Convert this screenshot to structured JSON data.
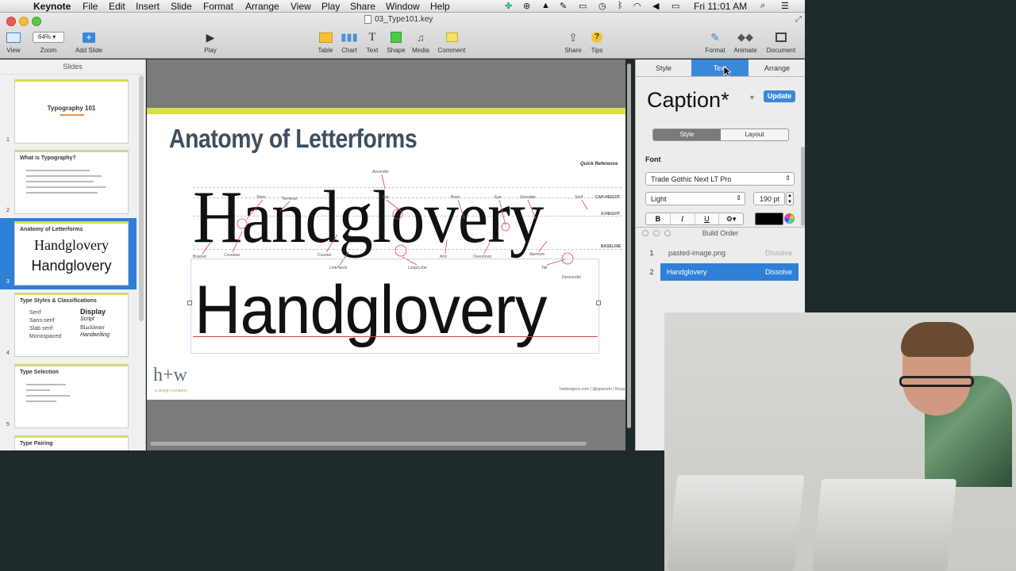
{
  "menubar": {
    "apple_icon": "apple-icon",
    "app_name": "Keynote",
    "menus": [
      "File",
      "Edit",
      "Insert",
      "Slide",
      "Format",
      "Arrange",
      "View",
      "Play",
      "Share",
      "Window",
      "Help"
    ],
    "clock": "Fri 11:01 AM"
  },
  "window": {
    "title": "03_Type101.key"
  },
  "toolbar": {
    "view_label": "View",
    "zoom_value": "64%",
    "zoom_label": "Zoom",
    "add_slide_label": "Add Slide",
    "play_label": "Play",
    "table_label": "Table",
    "chart_label": "Chart",
    "text_label": "Text",
    "shape_label": "Shape",
    "media_label": "Media",
    "comment_label": "Comment",
    "share_label": "Share",
    "tips_label": "Tips",
    "format_label": "Format",
    "animate_label": "Animate",
    "document_label": "Document"
  },
  "sidebar": {
    "header": "Slides",
    "slides": [
      {
        "num": "1",
        "title": "Typography 101"
      },
      {
        "num": "2",
        "title": "What is Typography?"
      },
      {
        "num": "3",
        "title": "Anatomy of Letterforms",
        "word1": "Handglovery",
        "word2": "Handglovery"
      },
      {
        "num": "4",
        "title": "Type Styles & Classifications",
        "left": [
          "Serif",
          "Sans-serif",
          "Slab serif",
          "Monospaced"
        ],
        "right": [
          "Display",
          "Script",
          "Blackletter",
          "Handwriting"
        ]
      },
      {
        "num": "5",
        "title": "Type Selection"
      },
      {
        "num": "6",
        "title": "Type Pairing"
      }
    ]
  },
  "slide": {
    "title": "Anatomy of Letterforms",
    "quick_reference": "Quick Reference",
    "serif_word": "Handglovery",
    "sans_word": "Handglovery",
    "labels": {
      "ascender": "Ascender",
      "stem": "Stem",
      "terminal": "Terminal",
      "ear": "Ear",
      "bowl": "Bowl",
      "eye": "Eye",
      "shoulder": "Shoulder",
      "serif": "Serif",
      "cap_height": "CAP-HEIGHT",
      "x_height": "X-HEIGHT",
      "baseline": "BASELINE",
      "bracket": "Bracket",
      "crossbar": "Crossbar",
      "counter": "Counter",
      "arm": "Arm",
      "overshoot": "Overshoot",
      "aperture": "Aperture",
      "link_neck": "Link/Neck",
      "loop_lobe": "Loop/Lobe",
      "tail": "Tail",
      "descender": "Descender"
    },
    "logo_text": "h+w",
    "logo_sub": "a design company",
    "footer": "hwdesignco.com | @jsparreto | Respo"
  },
  "inspector": {
    "tabs": [
      "Style",
      "Text",
      "Arrange"
    ],
    "active_tab": "Text",
    "paragraph_style": "Caption*",
    "update_label": "Update",
    "subtabs": [
      "Style",
      "Layout"
    ],
    "font_heading": "Font",
    "font_family": "Trade Gothic Next LT Pro",
    "font_weight": "Light",
    "font_size": "190 pt",
    "bold": "B",
    "italic": "I",
    "underline": "U",
    "text_color": "#000000",
    "build_order_title": "Build Order",
    "build_items": [
      {
        "num": "1",
        "name": "pasted-image.png",
        "effect": "Dissolve"
      },
      {
        "num": "2",
        "name": "Handglovery",
        "effect": "Dissolve"
      }
    ]
  },
  "colors": {
    "accent_blue": "#3b88d8",
    "slide_yellow_green": "#d7e04a",
    "selection_blue": "#2f7fd6",
    "annotation_red": "#d84050"
  }
}
